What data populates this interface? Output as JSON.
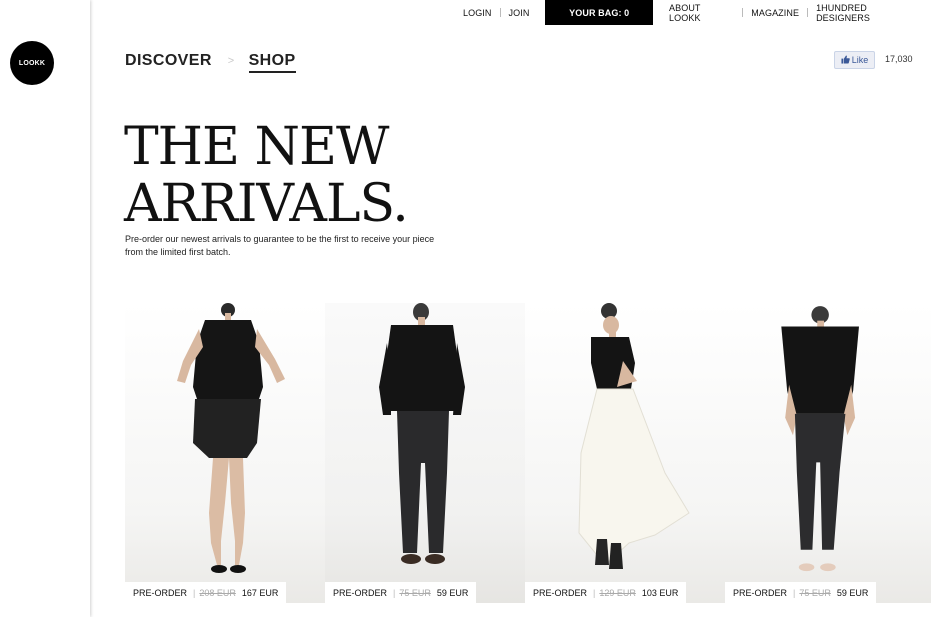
{
  "brand": {
    "logo_text": "LOOKK"
  },
  "topnav": {
    "login": "LOGIN",
    "join": "JOIN",
    "bag": "YOUR BAG: 0",
    "about": "ABOUT LOOKK",
    "magazine": "MAGAZINE",
    "designers": "1HUNDRED DESIGNERS"
  },
  "breadcrumb": {
    "discover": "DISCOVER",
    "separator": ">",
    "shop": "SHOP"
  },
  "social": {
    "like_label": "Like",
    "like_count": "17,030"
  },
  "hero": {
    "title_line1": "THE NEW",
    "title_line2": "ARRIVALS.",
    "description": "Pre-order our newest arrivals to guarantee to be the first to receive your piece from the limited first batch."
  },
  "products": [
    {
      "status": "PRE-ORDER",
      "old_price": "208 EUR",
      "price": "167 EUR"
    },
    {
      "status": "PRE-ORDER",
      "old_price": "75 EUR",
      "price": "59 EUR"
    },
    {
      "status": "PRE-ORDER",
      "old_price": "129 EUR",
      "price": "103 EUR"
    },
    {
      "status": "PRE-ORDER",
      "old_price": "75 EUR",
      "price": "59 EUR"
    }
  ],
  "colors": {
    "accent": "#000000",
    "facebook": "#3b5998",
    "page_bg": "#ffffff"
  }
}
